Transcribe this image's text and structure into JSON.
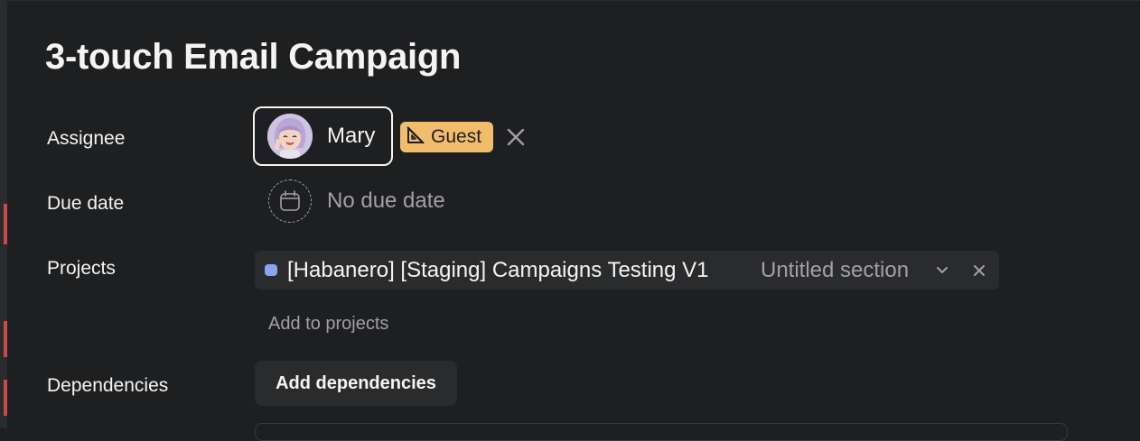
{
  "task": {
    "title": "3-touch Email Campaign"
  },
  "fields": {
    "assignee_label": "Assignee",
    "due_date_label": "Due date",
    "projects_label": "Projects",
    "dependencies_label": "Dependencies"
  },
  "assignee": {
    "name": "Mary",
    "badge": "Guest",
    "avatar_icon": "memoji-avatar-icon",
    "badge_icon": "guest-ruler-icon",
    "remove_icon": "close-icon"
  },
  "due_date": {
    "value": "No due date",
    "icon": "calendar-icon"
  },
  "projects": {
    "items": [
      {
        "name": "[Habanero] [Staging] Campaigns Testing V1",
        "section": "Untitled section",
        "color": "#8da3f1"
      }
    ],
    "add_label": "Add to projects"
  },
  "dependencies": {
    "add_label": "Add dependencies"
  },
  "colors": {
    "background": "#1e1f21",
    "surface": "#2a2b2d",
    "text_primary": "#f5f4f3",
    "text_secondary": "#a2a0a2",
    "guest_badge": "#f1bd6c"
  }
}
